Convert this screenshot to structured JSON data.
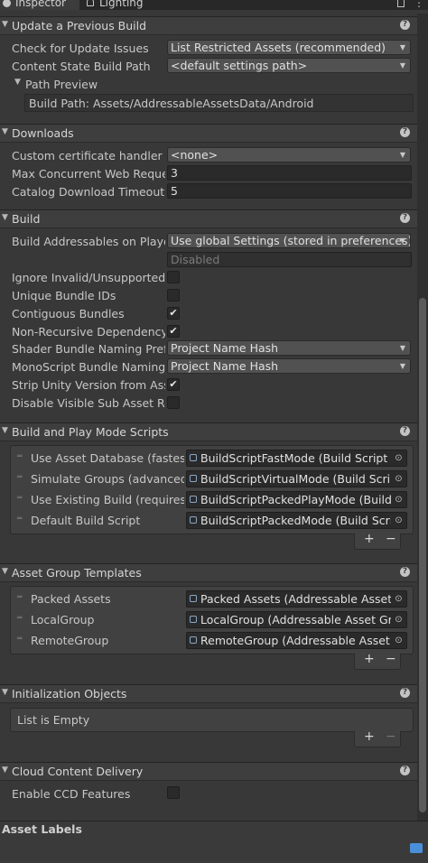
{
  "tabs": [
    {
      "label": "Inspector",
      "icon": "info-icon"
    },
    {
      "label": "Lighting",
      "icon": "lightbulb-icon"
    }
  ],
  "sections": {
    "update": {
      "title": "Update a Previous Build",
      "check_label": "Check for Update Issues",
      "check_value": "List Restricted Assets (recommended)",
      "content_state_label": "Content State Build Path",
      "content_state_value": "<default settings path>",
      "path_preview_label": "Path Preview",
      "build_path": "Build Path: Assets/AddressableAssetsData/Android"
    },
    "downloads": {
      "title": "Downloads",
      "cert_label": "Custom certificate handler",
      "cert_value": "<none>",
      "max_label": "Max Concurrent Web Requests",
      "max_value": "3",
      "timeout_label": "Catalog Download Timeout",
      "timeout_value": "5"
    },
    "build": {
      "title": "Build",
      "build_on_player_label": "Build Addressables on Player Build",
      "build_on_player_value": "Use global Settings (stored in preferences)",
      "disabled_text": "Disabled",
      "ignore_invalid_label": "Ignore Invalid/Unsupported Files",
      "ignore_invalid_checked": false,
      "unique_ids_label": "Unique Bundle IDs",
      "unique_ids_checked": false,
      "contiguous_label": "Contiguous Bundles",
      "contiguous_checked": true,
      "non_recursive_label": "Non-Recursive Dependency Calculation",
      "non_recursive_checked": true,
      "shader_prefix_label": "Shader Bundle Naming Prefix",
      "shader_prefix_value": "Project Name Hash",
      "monoscript_label": "MonoScript Bundle Naming Prefix",
      "monoscript_value": "Project Name Hash",
      "strip_unity_label": "Strip Unity Version from AssetBundles",
      "strip_unity_checked": true,
      "disable_visible_label": "Disable Visible Sub Asset Representations",
      "disable_visible_checked": false
    },
    "play_mode": {
      "title": "Build and Play Mode Scripts",
      "items": [
        {
          "label": "Use Asset Database (fastest)",
          "value": "BuildScriptFastMode (Build Script Fast Mode)"
        },
        {
          "label": "Simulate Groups (advanced)",
          "value": "BuildScriptVirtualMode (Build Script Virtual Mode)"
        },
        {
          "label": "Use Existing Build (requires built groups)",
          "value": "BuildScriptPackedPlayMode (Build Script Packed Play Mode)"
        },
        {
          "label": "Default Build Script",
          "value": "BuildScriptPackedMode (Build Script Packed Mode)"
        }
      ]
    },
    "templates": {
      "title": "Asset Group Templates",
      "items": [
        {
          "label": "Packed Assets",
          "value": "Packed Assets (Addressable Asset Group Template)"
        },
        {
          "label": "LocalGroup",
          "value": "LocalGroup (Addressable Asset Group Template)"
        },
        {
          "label": "RemoteGroup",
          "value": "RemoteGroup (Addressable Asset Group Template)"
        }
      ]
    },
    "init": {
      "title": "Initialization Objects",
      "empty_text": "List is Empty"
    },
    "ccd": {
      "title": "Cloud Content Delivery",
      "enable_label": "Enable CCD Features",
      "enable_checked": false
    }
  },
  "asset_labels": "Asset Labels",
  "plus_label": "+",
  "minus_label": "−",
  "colors": {
    "background": "#383838",
    "header": "#3e3e3e",
    "field": "#2a2a2a",
    "dropdown": "#515151"
  }
}
